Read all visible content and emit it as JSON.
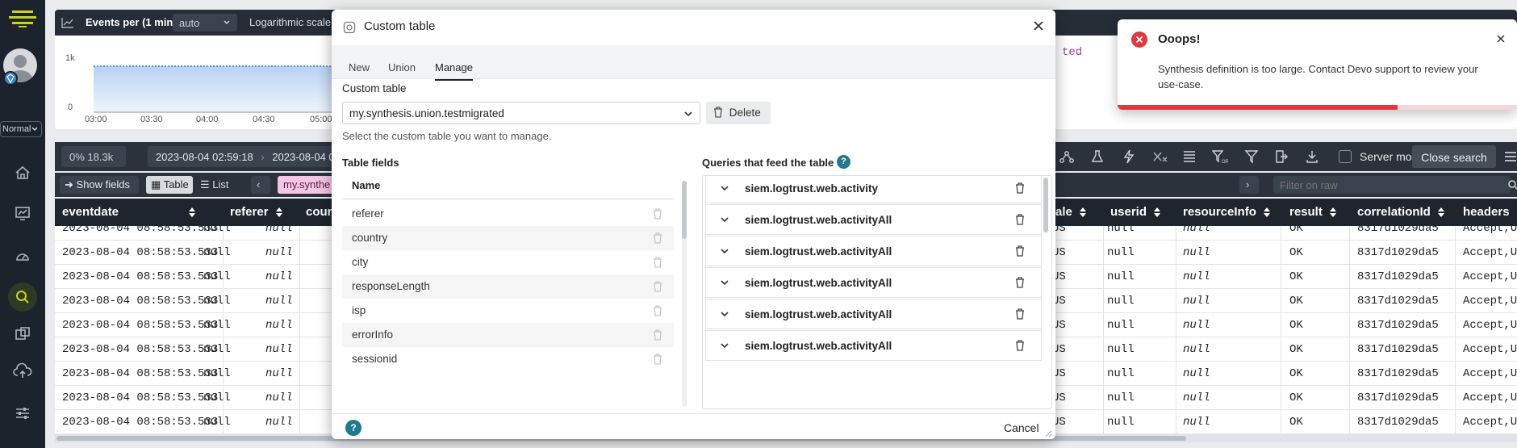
{
  "sidebar": {
    "view_mode": "Normal",
    "nav": [
      "home-icon",
      "dashboard-icon",
      "speedometer-icon",
      "search-icon",
      "applications-icon",
      "cloud-upload-icon",
      "sliders-icon"
    ]
  },
  "chart": {
    "title": "Events per (1 min)",
    "interval": "auto",
    "log_scale_label": "Logarithmic scale",
    "y_ticks": [
      "1k",
      "0"
    ],
    "x_ticks": [
      "03:00",
      "03:30",
      "04:00",
      "04:30",
      "05:00"
    ],
    "query_fragment": "ted"
  },
  "toolbar": {
    "progress": "0% 18.3k",
    "date_from": "2023-08-04 02:59:18",
    "date_to": "2023-08-04 0",
    "server_mode": "Server mode",
    "close_search": "Close search"
  },
  "subbar": {
    "show_fields": "Show fields",
    "table": "Table",
    "list": "List",
    "table_chip": "my.synthe",
    "filter_placeholder": "Filter on raw"
  },
  "table": {
    "columns": [
      "eventdate",
      "referer",
      "coun",
      "ale",
      "userid",
      "resourceInfo",
      "result",
      "correlationId",
      "headers"
    ],
    "rows": [
      {
        "eventdate": "2023-08-04 08:58:53.533",
        "referer": "null",
        "country": "null",
        "ale": "US",
        "userid": "null",
        "resource": "null",
        "result": "OK",
        "corr": "8317d1029da5",
        "headers": "Accept,Us"
      },
      {
        "eventdate": "2023-08-04 08:58:53.533",
        "referer": "null",
        "country": "null",
        "ale": "US",
        "userid": "null",
        "resource": "null",
        "result": "OK",
        "corr": "8317d1029da5",
        "headers": "Accept,Us"
      },
      {
        "eventdate": "2023-08-04 08:58:53.533",
        "referer": "null",
        "country": "null",
        "ale": "US",
        "userid": "null",
        "resource": "null",
        "result": "OK",
        "corr": "8317d1029da5",
        "headers": "Accept,Us"
      },
      {
        "eventdate": "2023-08-04 08:58:53.533",
        "referer": "null",
        "country": "null",
        "ale": "US",
        "userid": "null",
        "resource": "null",
        "result": "OK",
        "corr": "8317d1029da5",
        "headers": "Accept,Us"
      },
      {
        "eventdate": "2023-08-04 08:58:53.533",
        "referer": "null",
        "country": "null",
        "ale": "US",
        "userid": "null",
        "resource": "null",
        "result": "OK",
        "corr": "8317d1029da5",
        "headers": "Accept,Us"
      },
      {
        "eventdate": "2023-08-04 08:58:53.533",
        "referer": "null",
        "country": "null",
        "ale": "US",
        "userid": "null",
        "resource": "null",
        "result": "OK",
        "corr": "8317d1029da5",
        "headers": "Accept,Us"
      },
      {
        "eventdate": "2023-08-04 08:58:53.533",
        "referer": "null",
        "country": "null",
        "ale": "US",
        "userid": "null",
        "resource": "null",
        "result": "OK",
        "corr": "8317d1029da5",
        "headers": "Accept,Us"
      },
      {
        "eventdate": "2023-08-04 08:58:53.533",
        "referer": "null",
        "country": "null",
        "ale": "US",
        "userid": "null",
        "resource": "null",
        "result": "OK",
        "corr": "8317d1029da5",
        "headers": "Accept,Us"
      },
      {
        "eventdate": "2023-08-04 08:58:53.533",
        "referer": "null",
        "country": "null",
        "ale": "US",
        "userid": "null",
        "resource": "null",
        "result": "OK",
        "corr": "8317d1029da5",
        "headers": "Accept,Us"
      }
    ]
  },
  "modal": {
    "title": "Custom table",
    "tabs": [
      "New",
      "Union",
      "Manage"
    ],
    "active_tab": "Manage",
    "custom_table_label": "Custom table",
    "selected_table": "my.synthesis.union.testmigrated",
    "delete_label": "Delete",
    "help_text": "Select the custom table you want to manage.",
    "fields_heading": "Table fields",
    "fields_column": "Name",
    "fields": [
      "referer",
      "country",
      "city",
      "responseLength",
      "isp",
      "errorInfo",
      "sessionid"
    ],
    "queries_heading": "Queries that feed the table",
    "queries": [
      "siem.logtrust.web.activity",
      "siem.logtrust.web.activityAll",
      "siem.logtrust.web.activityAll",
      "siem.logtrust.web.activityAll",
      "siem.logtrust.web.activityAll",
      "siem.logtrust.web.activityAll"
    ],
    "cancel_label": "Cancel"
  },
  "toast": {
    "title": "Ooops!",
    "message_line1": "Synthesis definition is too large. Contact Devo support to review your",
    "message_line2": "use-case.",
    "progress": 0.7
  },
  "colors": {
    "accent_teal": "#1e7a8c",
    "error_red": "#e0383e",
    "sidebar_bg": "#1c232d",
    "chip_pink": "#f3c6e3"
  }
}
